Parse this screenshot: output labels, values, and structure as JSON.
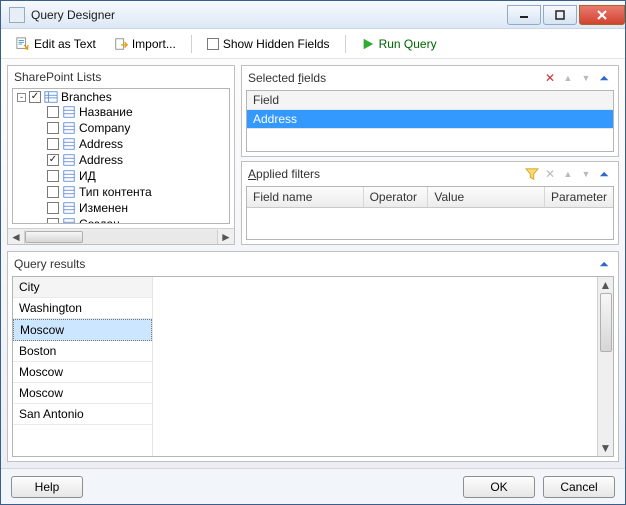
{
  "window": {
    "title": "Query Designer"
  },
  "toolbar": {
    "edit_as_text": "Edit as Text",
    "import": "Import...",
    "show_hidden": "Show Hidden Fields",
    "run_query": "Run Query"
  },
  "sp_lists": {
    "label": "SharePoint Lists",
    "root_label": "Branches",
    "items": [
      {
        "label": "Название",
        "checked": false
      },
      {
        "label": "Company",
        "checked": false
      },
      {
        "label": "Address",
        "checked": false
      },
      {
        "label": "Address",
        "checked": true
      },
      {
        "label": "ИД",
        "checked": false
      },
      {
        "label": "Тип контента",
        "checked": false
      },
      {
        "label": "Изменен",
        "checked": false
      },
      {
        "label": "Создан",
        "checked": false
      }
    ]
  },
  "selected_fields": {
    "label_prefix": "Selected ",
    "label_u": "f",
    "label_suffix": "ields",
    "header": "Field",
    "items": [
      {
        "label": "Address",
        "selected": true
      }
    ]
  },
  "applied_filters": {
    "label_u": "A",
    "label_suffix": "pplied filters",
    "cols": {
      "field": "Field name",
      "operator": "Operator",
      "value": "Value",
      "parameter": "Parameter"
    }
  },
  "query_results": {
    "label": "Query results",
    "col_header": "City",
    "rows": [
      {
        "v": "Washington",
        "sel": false
      },
      {
        "v": "Moscow",
        "sel": true
      },
      {
        "v": "Boston",
        "sel": false
      },
      {
        "v": "Moscow",
        "sel": false
      },
      {
        "v": "Moscow",
        "sel": false
      },
      {
        "v": "San Antonio",
        "sel": false
      }
    ]
  },
  "footer": {
    "help": "Help",
    "ok": "OK",
    "cancel": "Cancel"
  },
  "icons": {
    "edit_text": "edit-text-icon",
    "import": "import-icon",
    "run": "play-icon",
    "branches": "list-icon",
    "field": "field-icon",
    "delete": "delete-icon",
    "up": "arrow-up-icon",
    "down": "arrow-down-icon",
    "collapse": "chevrons-icon",
    "funnel": "funnel-icon"
  }
}
